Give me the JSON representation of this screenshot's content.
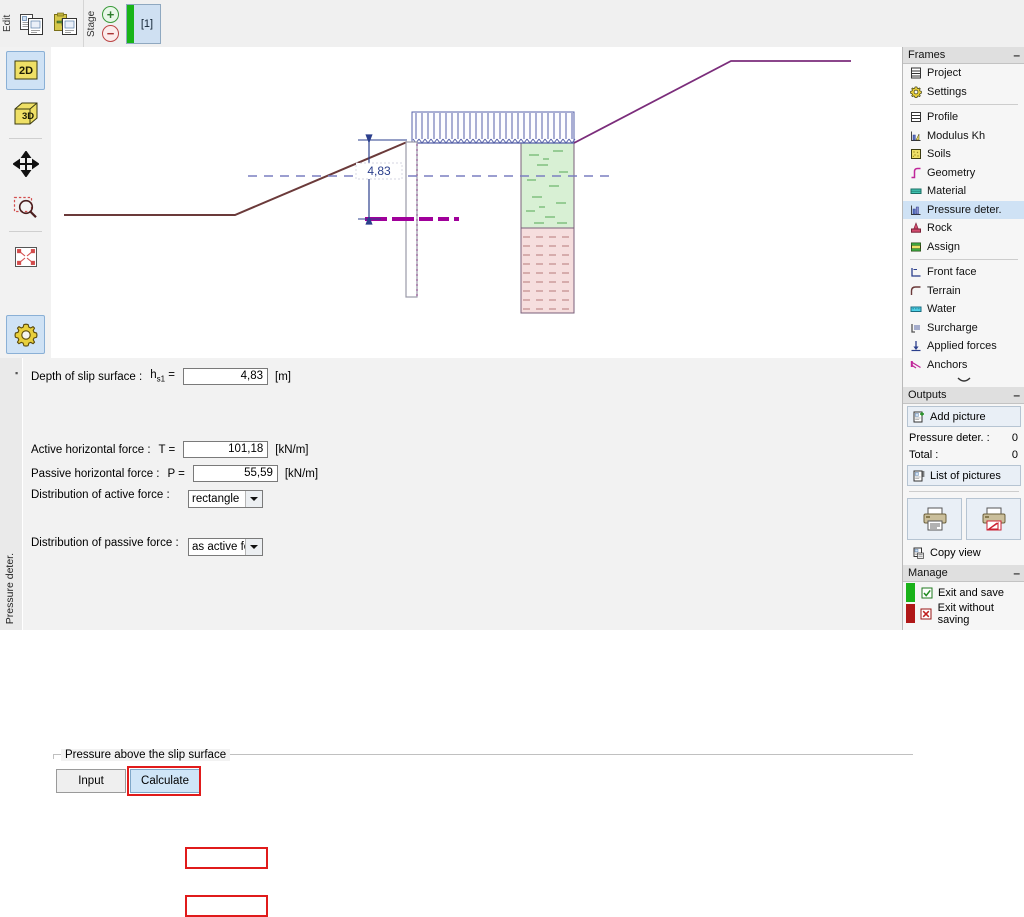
{
  "toolbar": {
    "edit_label": "Edit",
    "stage_label": "Stage",
    "copy_icon": "copy-icon",
    "paste_icon": "paste-icon",
    "add_stage_icon": "plus-circle-icon",
    "remove_stage_icon": "minus-circle-icon",
    "stage_tab_label": "[1]"
  },
  "leftrail": {
    "items": [
      {
        "name": "view-2d",
        "icon": "2d-icon",
        "label": "2D",
        "selected": true
      },
      {
        "name": "view-3d",
        "icon": "3d-icon",
        "label": "3D",
        "selected": false
      },
      {
        "name": "pan-tool",
        "icon": "move-arrows-icon",
        "label": "",
        "selected": false
      },
      {
        "name": "zoom-window-tool",
        "icon": "zoom-rectangle-icon",
        "label": "",
        "selected": false
      },
      {
        "name": "zoom-all-tool",
        "icon": "fit-to-screen-icon",
        "label": "",
        "selected": false
      },
      {
        "name": "drawing-settings",
        "icon": "gear-icon",
        "label": "",
        "selected": false
      }
    ]
  },
  "canvas": {
    "dimension_label": "4,83",
    "colors": {
      "terrain": "#6b3a3a",
      "slope": "#7b2d7b",
      "surcharge": "#5560a8",
      "dimension": "#2b3f8c",
      "water_table": "#7a7fc0",
      "slip_surface": "#a0009a",
      "soil_upper": "#d8f0d4",
      "soil_lower": "#f6dede",
      "wall": "#9a9aa8"
    }
  },
  "form": {
    "depth_row": {
      "label": "Depth of slip surface :",
      "symbol": "h",
      "symbol_sub": "s1",
      "symbol_eq": "=",
      "value": "4,83",
      "unit": "[m]"
    },
    "group_title": "Pressure above the slip surface",
    "input_button": "Input",
    "calculate_button": "Calculate",
    "active_force": {
      "label": "Active horizontal force :",
      "symbol": "T =",
      "value": "101,18",
      "unit": "[kN/m]"
    },
    "passive_force": {
      "label": "Passive horizontal force :",
      "symbol": "P =",
      "value": "55,59",
      "unit": "[kN/m]"
    },
    "active_distribution": {
      "label": "Distribution of active force :",
      "value": "rectangle"
    },
    "passive_distribution": {
      "label": "Distribution of passive force :",
      "value": "as active force"
    },
    "vertical_tab_label": "Pressure deter."
  },
  "sidebar": {
    "frames": {
      "title": "Frames",
      "minimize": "–",
      "items": [
        {
          "label": "Project",
          "icon": "project-icon",
          "selected": false
        },
        {
          "label": "Settings",
          "icon": "gear-icon",
          "selected": false
        },
        {
          "divider": true
        },
        {
          "label": "Profile",
          "icon": "profile-icon",
          "selected": false
        },
        {
          "label": "Modulus Kh",
          "icon": "modulus-icon",
          "selected": false
        },
        {
          "label": "Soils",
          "icon": "soils-icon",
          "selected": false
        },
        {
          "label": "Geometry",
          "icon": "geometry-icon",
          "selected": false
        },
        {
          "label": "Material",
          "icon": "material-icon",
          "selected": false
        },
        {
          "label": "Pressure deter.",
          "icon": "pressure-icon",
          "selected": true
        },
        {
          "label": "Rock",
          "icon": "rock-icon",
          "selected": false
        },
        {
          "label": "Assign",
          "icon": "assign-icon",
          "selected": false
        },
        {
          "divider": true
        },
        {
          "label": "Front face",
          "icon": "front-face-icon",
          "selected": false
        },
        {
          "label": "Terrain",
          "icon": "terrain-icon",
          "selected": false
        },
        {
          "label": "Water",
          "icon": "water-icon",
          "selected": false
        },
        {
          "label": "Surcharge",
          "icon": "surcharge-icon",
          "selected": false
        },
        {
          "label": "Applied forces",
          "icon": "applied-forces-icon",
          "selected": false
        },
        {
          "label": "Anchors",
          "icon": "anchors-icon",
          "selected": false
        }
      ],
      "more_chevron": "chevron-down-icon"
    },
    "outputs": {
      "title": "Outputs",
      "minimize": "–",
      "add_picture": "Add picture",
      "rows": [
        {
          "label": "Pressure deter. :",
          "value": "0"
        },
        {
          "label": "Total :",
          "value": "0"
        }
      ],
      "list_of_pictures": "List of pictures",
      "print_icon": "printer-icon",
      "print_preview_icon": "printer-preview-icon",
      "copy_view": "Copy view"
    },
    "manage": {
      "title": "Manage",
      "minimize": "–",
      "exit_save": "Exit and save",
      "exit_nosave": "Exit without saving",
      "save_color": "#19b219",
      "nosave_color": "#b01818"
    }
  }
}
